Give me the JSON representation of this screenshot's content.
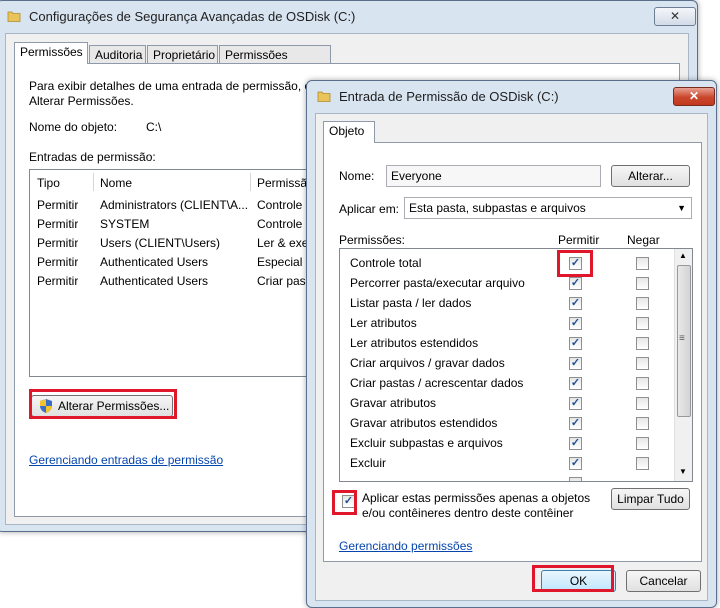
{
  "back_window": {
    "title": "Configurações de Segurança Avançadas de OSDisk (C:)",
    "close": "✕",
    "tabs": [
      "Permissões",
      "Auditoria",
      "Proprietário",
      "Permissões Efetivas"
    ],
    "intro_line1": "Para exibir detalhes de uma entrada de permissão, cl",
    "intro_line2": "Alterar Permissões.",
    "object_label": "Nome do objeto:",
    "object_value": "C:\\",
    "entries_label": "Entradas de permissão:",
    "columns": [
      "Tipo",
      "Nome",
      "Permissã"
    ],
    "rows": [
      {
        "type": "Permitir",
        "name": "Administrators (CLIENT\\A...",
        "perm": "Controle"
      },
      {
        "type": "Permitir",
        "name": "SYSTEM",
        "perm": "Controle"
      },
      {
        "type": "Permitir",
        "name": "Users (CLIENT\\Users)",
        "perm": "Ler & exe"
      },
      {
        "type": "Permitir",
        "name": "Authenticated Users",
        "perm": "Especial"
      },
      {
        "type": "Permitir",
        "name": "Authenticated Users",
        "perm": "Criar pas"
      }
    ],
    "change_button": "Alterar Permissões...",
    "manage_link": "Gerenciando entradas de permissão"
  },
  "front_window": {
    "title": "Entrada de Permissão de OSDisk (C:)",
    "close": "✕",
    "tab": "Objeto",
    "name_label": "Nome:",
    "name_value": "Everyone",
    "change_button": "Alterar...",
    "apply_label": "Aplicar em:",
    "apply_value": "Esta pasta, subpastas e arquivos",
    "perm_label": "Permissões:",
    "allow_header": "Permitir",
    "deny_header": "Negar",
    "permissions": [
      {
        "name": "Controle total",
        "allow": true,
        "deny": false
      },
      {
        "name": "Percorrer pasta/executar arquivo",
        "allow": true,
        "deny": false
      },
      {
        "name": "Listar pasta / ler dados",
        "allow": true,
        "deny": false
      },
      {
        "name": "Ler atributos",
        "allow": true,
        "deny": false
      },
      {
        "name": "Ler atributos estendidos",
        "allow": true,
        "deny": false
      },
      {
        "name": "Criar arquivos / gravar dados",
        "allow": true,
        "deny": false
      },
      {
        "name": "Criar pastas / acrescentar dados",
        "allow": true,
        "deny": false
      },
      {
        "name": "Gravar atributos",
        "allow": true,
        "deny": false
      },
      {
        "name": "Gravar atributos estendidos",
        "allow": true,
        "deny": false
      },
      {
        "name": "Excluir subpastas e arquivos",
        "allow": true,
        "deny": false
      },
      {
        "name": "Excluir",
        "allow": true,
        "deny": false
      }
    ],
    "apply_only_line1": "Aplicar estas permissões apenas a objetos",
    "apply_only_line2": "e/ou contêineres dentro deste contêiner",
    "clear_button": "Limpar Tudo",
    "manage_link": "Gerenciando permissões",
    "ok_button": "OK",
    "cancel_button": "Cancelar"
  },
  "colors": {
    "highlight": "#e0162b",
    "link": "#0645ad",
    "check": "#1e4f8c"
  }
}
